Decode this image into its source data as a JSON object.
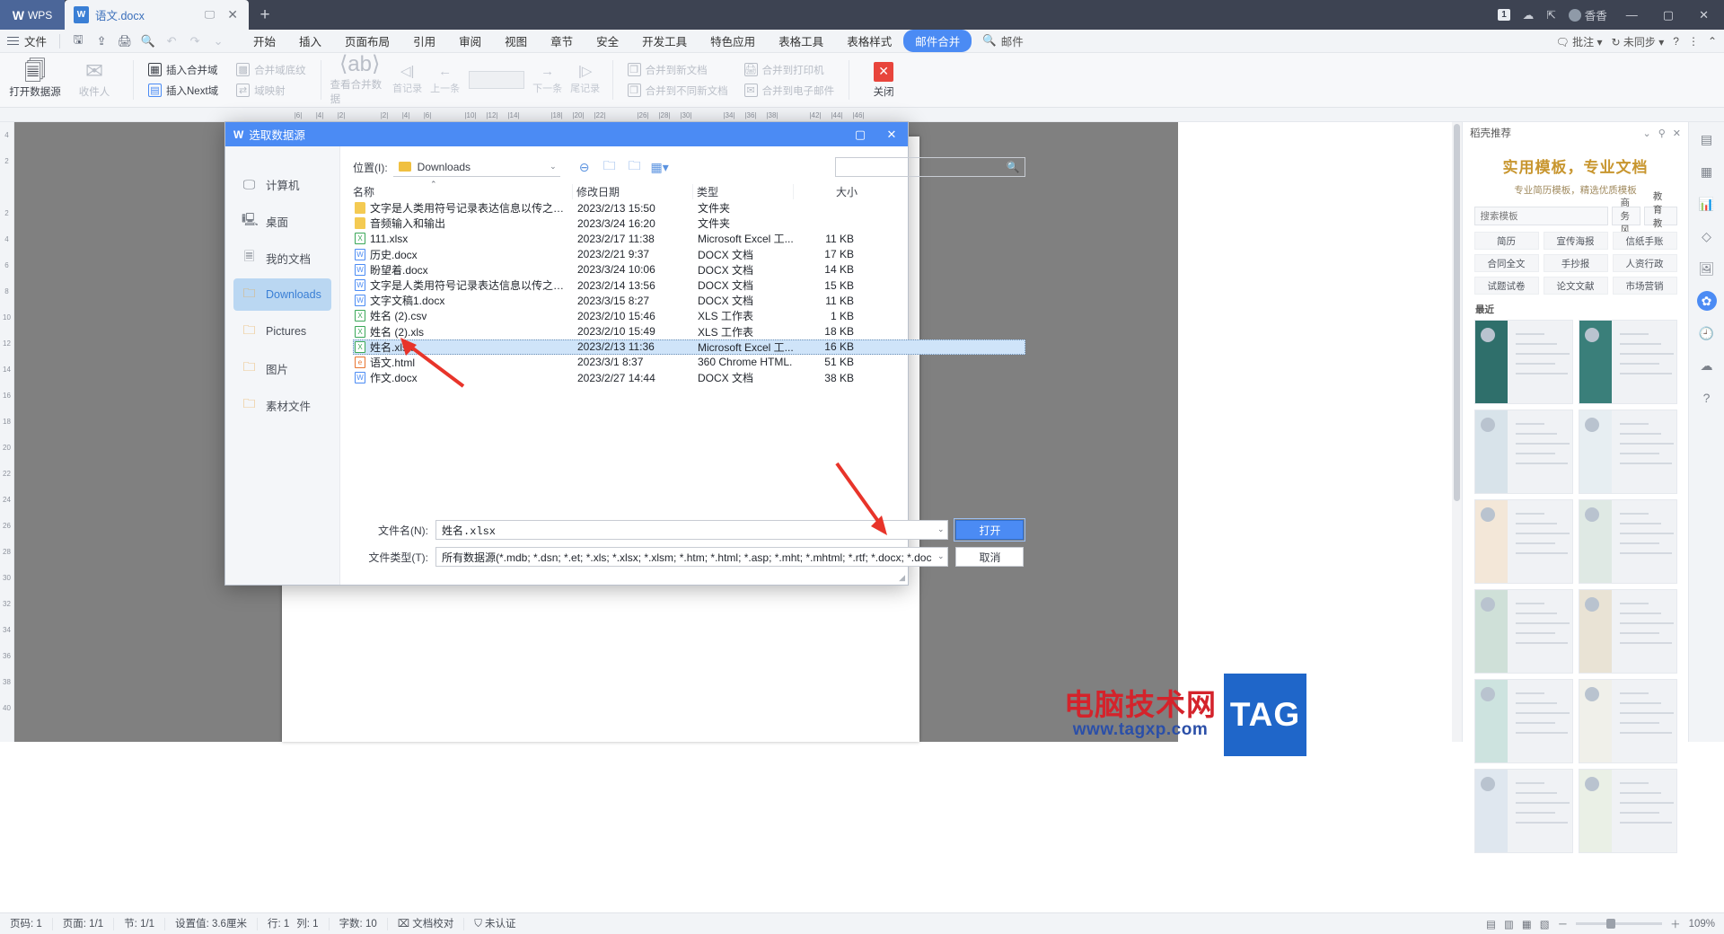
{
  "titlebar": {
    "wps_label": "WPS",
    "tab_name": "语文.docx",
    "tab_icon": "word-doc-icon",
    "new_tab": "+",
    "right_items": [
      {
        "label": "1",
        "icon": "page-count-badge"
      },
      {
        "label": "",
        "icon": "cloud-icon"
      },
      {
        "label": "",
        "icon": "share-icon"
      },
      {
        "label": "香香",
        "icon": "user-avatar"
      }
    ],
    "window_buttons": [
      "—",
      "▢",
      "✕"
    ]
  },
  "menubar": {
    "file_label": "文件",
    "quick_icons": [
      "save-icon",
      "cloud-sync-icon",
      "print-icon",
      "print-preview-icon",
      "undo-icon",
      "redo-icon",
      "more-icon"
    ],
    "tabs": [
      {
        "label": "开始",
        "active": false
      },
      {
        "label": "插入",
        "active": false
      },
      {
        "label": "页面布局",
        "active": false
      },
      {
        "label": "引用",
        "active": false
      },
      {
        "label": "审阅",
        "active": false
      },
      {
        "label": "视图",
        "active": false
      },
      {
        "label": "章节",
        "active": false
      },
      {
        "label": "安全",
        "active": false
      },
      {
        "label": "开发工具",
        "active": false
      },
      {
        "label": "特色应用",
        "active": false
      },
      {
        "label": "表格工具",
        "active": false
      },
      {
        "label": "表格样式",
        "active": false
      },
      {
        "label": "邮件合并",
        "active": true
      }
    ],
    "search_label": "邮件",
    "right": [
      {
        "label": "批注",
        "icon": "comment-icon"
      },
      {
        "label": "未同步",
        "icon": "sync-icon"
      },
      {
        "label": "",
        "icon": "help-icon"
      },
      {
        "label": "",
        "icon": "menu-dots-icon"
      },
      {
        "label": "",
        "icon": "collapse-ribbon-icon"
      }
    ]
  },
  "ribbon": {
    "open_source": {
      "label": "打开数据源",
      "icon": "open-data-source-icon",
      "has_dropdown": true
    },
    "recipients": {
      "label": "收件人",
      "icon": "recipients-icon",
      "disabled": true
    },
    "insert_merge_field": {
      "label": "插入合并域",
      "icon": "insert-merge-field-icon"
    },
    "insert_next_field": {
      "label": "插入Next域",
      "icon": "insert-next-field-icon"
    },
    "merge_shading": {
      "label": "合并域底纹",
      "icon": "merge-shading-icon",
      "disabled": true
    },
    "field_mapping": {
      "label": "域映射",
      "icon": "field-mapping-icon",
      "disabled": true
    },
    "view_merge_data": {
      "label": "查看合并数据",
      "icon": "view-merge-data-icon",
      "disabled": true
    },
    "first_record": {
      "label": "首记录",
      "icon": "first-record-icon",
      "disabled": true
    },
    "prev_record": {
      "label": "上一条",
      "icon": "prev-record-icon",
      "disabled": true
    },
    "record_box_value": "",
    "next_record": {
      "label": "下一条",
      "icon": "next-record-icon",
      "disabled": true
    },
    "last_record": {
      "label": "尾记录",
      "icon": "last-record-icon",
      "disabled": true
    },
    "merge_to_new_doc": {
      "label": "合并到新文档",
      "icon": "merge-new-doc-icon",
      "disabled": true
    },
    "merge_to_printer": {
      "label": "合并到打印机",
      "icon": "merge-printer-icon",
      "disabled": true
    },
    "merge_to_diff_docs": {
      "label": "合并到不同新文档",
      "icon": "merge-diff-docs-icon",
      "disabled": true
    },
    "merge_to_email": {
      "label": "合并到电子邮件",
      "icon": "merge-email-icon",
      "disabled": true
    },
    "close": {
      "label": "关闭",
      "icon": "close-mailmerge-icon"
    }
  },
  "ruler": {
    "h_ticks": [
      "6",
      "4",
      "2",
      "",
      "2",
      "4",
      "6",
      "",
      "10",
      "12",
      "14",
      "",
      "18",
      "20",
      "22",
      "",
      "26",
      "28",
      "30",
      "",
      "34",
      "36",
      "38",
      "",
      "42",
      "44",
      "46"
    ],
    "v_ticks": [
      "4",
      "2",
      "",
      "2",
      "4",
      "6",
      "8",
      "10",
      "12",
      "14",
      "16",
      "18",
      "20",
      "22",
      "24",
      "26",
      "28",
      "30",
      "32",
      "34",
      "36",
      "38",
      "40"
    ]
  },
  "dialog": {
    "title": "选取数据源",
    "logo": "wps-logo-icon",
    "window_buttons": [
      "▢",
      "✕"
    ],
    "sidebar": [
      {
        "label": "计算机",
        "icon": "computer-icon",
        "active": false
      },
      {
        "label": "桌面",
        "icon": "desktop-icon",
        "active": false
      },
      {
        "label": "我的文档",
        "icon": "my-documents-icon",
        "active": false
      },
      {
        "label": "Downloads",
        "icon": "folder-icon",
        "active": true
      },
      {
        "label": "Pictures",
        "icon": "folder-icon",
        "active": false
      },
      {
        "label": "图片",
        "icon": "folder-icon",
        "active": false
      },
      {
        "label": "素材文件",
        "icon": "folder-icon",
        "active": false
      }
    ],
    "location": {
      "label": "位置(I):",
      "value": "Downloads",
      "icons": [
        "back-icon",
        "up-folder-icon",
        "new-folder-icon",
        "view-mode-icon"
      ]
    },
    "search_placeholder": "",
    "search_icon": "search-icon",
    "columns": [
      "名称",
      "修改日期",
      "类型",
      "大小"
    ],
    "files": [
      {
        "name": "文字是人类用符号记录表达信息以传之久远的方式...",
        "date": "2023/2/13 15:50",
        "type": "文件夹",
        "size": "",
        "kind": "folder",
        "selected": false
      },
      {
        "name": "音频输入和输出",
        "date": "2023/3/24 16:20",
        "type": "文件夹",
        "size": "",
        "kind": "folder",
        "selected": false
      },
      {
        "name": "111.xlsx",
        "date": "2023/2/17 11:38",
        "type": "Microsoft Excel 工...",
        "size": "11 KB",
        "kind": "xlsx",
        "selected": false
      },
      {
        "name": "历史.docx",
        "date": "2023/2/21 9:37",
        "type": "DOCX 文档",
        "size": "17 KB",
        "kind": "docx",
        "selected": false
      },
      {
        "name": "盼望着.docx",
        "date": "2023/3/24 10:06",
        "type": "DOCX 文档",
        "size": "14 KB",
        "kind": "docx",
        "selected": false
      },
      {
        "name": "文字是人类用符号记录表达信息以传之久远的方式...",
        "date": "2023/2/14 13:56",
        "type": "DOCX 文档",
        "size": "15 KB",
        "kind": "docx",
        "selected": false
      },
      {
        "name": "文字文稿1.docx",
        "date": "2023/3/15 8:27",
        "type": "DOCX 文档",
        "size": "11 KB",
        "kind": "docx",
        "selected": false
      },
      {
        "name": "姓名 (2).csv",
        "date": "2023/2/10 15:46",
        "type": "XLS 工作表",
        "size": "1 KB",
        "kind": "csv",
        "selected": false
      },
      {
        "name": "姓名 (2).xls",
        "date": "2023/2/10 15:49",
        "type": "XLS 工作表",
        "size": "18 KB",
        "kind": "xls",
        "selected": false
      },
      {
        "name": "姓名.xlsx",
        "date": "2023/2/13 11:36",
        "type": "Microsoft Excel 工...",
        "size": "16 KB",
        "kind": "xlsx",
        "selected": true
      },
      {
        "name": "语文.html",
        "date": "2023/3/1 8:37",
        "type": "360 Chrome HTML...",
        "size": "51 KB",
        "kind": "html",
        "selected": false
      },
      {
        "name": "作文.docx",
        "date": "2023/2/27 14:44",
        "type": "DOCX 文档",
        "size": "38 KB",
        "kind": "docx",
        "selected": false
      }
    ],
    "filename_label": "文件名(N):",
    "filename_value": "姓名.xlsx",
    "filetype_label": "文件类型(T):",
    "filetype_value": "所有数据源(*.mdb; *.dsn; *.et; *.xls; *.xlsx; *.xlsm; *.htm; *.html; *.asp; *.mht; *.mhtml; *.rtf; *.docx; *.doc",
    "open_button": "打开",
    "cancel_button": "取消"
  },
  "right_panel": {
    "header_label": "稻壳推荐",
    "header_icons": [
      "chevron-down-icon",
      "pin-icon",
      "close-icon"
    ],
    "title": "实用模板，专业文档",
    "subtitle": "专业简历模板，精选优质模板",
    "search_placeholder": "搜索模板",
    "chips": [
      "商务风",
      "教育教学"
    ],
    "tags": [
      "简历",
      "宣传海报",
      "信纸手账",
      "合同全文",
      "手抄报",
      "人资行政",
      "试题试卷",
      "论文文献",
      "市场营销"
    ],
    "recent_label": "最近"
  },
  "rail_icons": [
    "thumbnail-icon",
    "table-icon",
    "chart-icon",
    "shape-icon",
    "image-icon",
    "dochelper-icon",
    "history-icon",
    "backup-icon",
    "help-icon"
  ],
  "statusbar": {
    "items": [
      "页码: 1",
      "页面: 1/1",
      "节: 1/1",
      "设置值: 3.6厘米",
      "行: 1",
      "列: 1",
      "字数: 10",
      "文档校对",
      "未认证"
    ],
    "zoom_value": "109%",
    "view_icons": [
      "page-view-icon",
      "reading-view-icon",
      "outline-view-icon",
      "web-view-icon"
    ],
    "zoom_out": "－",
    "zoom_in": "＋"
  },
  "watermark": {
    "cn_text": "电脑技术网",
    "url_text": "www.tagxp.com",
    "tag_text": "TAG"
  },
  "colors": {
    "titlebar": "#3d4352",
    "accent": "#4b8bf4",
    "selection": "#cfe4f9",
    "sidebar_active": "#bad7f2",
    "arrow_red": "#e8342a",
    "watermark_red": "#d4232b",
    "watermark_blue": "#2b4fa8"
  }
}
